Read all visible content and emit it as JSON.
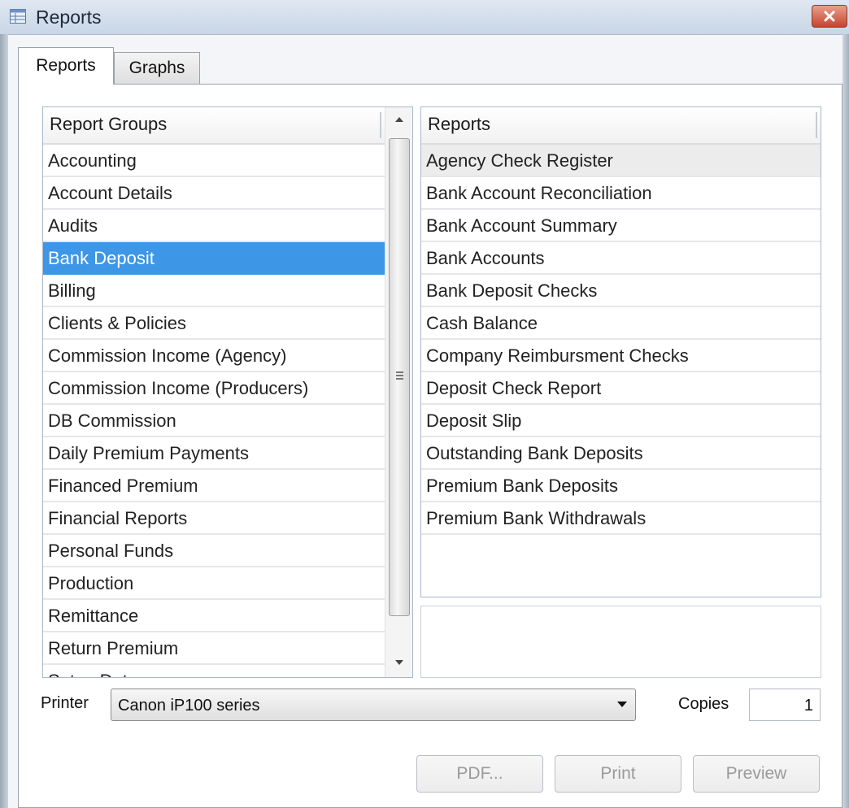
{
  "window": {
    "title": "Reports"
  },
  "tabs": [
    {
      "label": "Reports",
      "active": true
    },
    {
      "label": "Graphs",
      "active": false
    }
  ],
  "report_groups": {
    "header": "Report Groups",
    "items": [
      "Accounting",
      "Account Details",
      "Audits",
      "Bank Deposit",
      "Billing",
      "Clients & Policies",
      "Commission Income (Agency)",
      "Commission Income (Producers)",
      "DB Commission",
      "Daily Premium Payments",
      "Financed Premium",
      "Financial Reports",
      "Personal Funds",
      "Production",
      "Remittance",
      "Return Premium",
      "Setup Data"
    ],
    "selected": "Bank Deposit"
  },
  "reports": {
    "header": "Reports",
    "items": [
      "Agency Check Register",
      "Bank Account Reconciliation",
      "Bank Account Summary",
      "Bank Accounts",
      "Bank Deposit Checks",
      "Cash Balance",
      "Company Reimbursment Checks",
      "Deposit Check Report",
      "Deposit Slip",
      "Outstanding Bank Deposits",
      "Premium Bank Deposits",
      "Premium Bank Withdrawals"
    ],
    "highlighted": "Agency Check Register"
  },
  "printer": {
    "label": "Printer",
    "value": "Canon iP100 series"
  },
  "copies": {
    "label": "Copies",
    "value": "1"
  },
  "buttons": {
    "pdf": "PDF...",
    "print": "Print",
    "preview": "Preview"
  },
  "colors": {
    "selection": "#3d96e6",
    "close_button": "#c5442d"
  }
}
